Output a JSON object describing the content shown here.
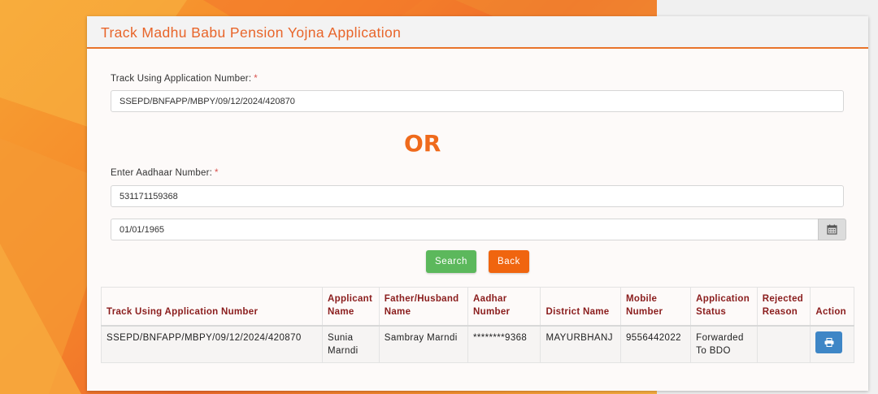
{
  "page": {
    "title": "Track Madhu Babu Pension Yojna Application",
    "or_text": "OR"
  },
  "form": {
    "app_number_label": "Track Using Application Number:",
    "app_number_value": "SSEPD/BNFAPP/MBPY/09/12/2024/420870",
    "aadhaar_label": "Enter Aadhaar Number:",
    "aadhaar_value": "531171159368",
    "dob_value": "01/01/1965",
    "required_mark": "*"
  },
  "buttons": {
    "search": "Search",
    "back": "Back"
  },
  "table": {
    "headers": [
      "Track Using Application Number",
      "Applicant Name",
      "Father/Husband Name",
      "Aadhar Number",
      "District Name",
      "Mobile Number",
      "Application Status",
      "Rejected Reason",
      "Action"
    ],
    "rows": [
      {
        "app_number": "SSEPD/BNFAPP/MBPY/09/12/2024/420870",
        "applicant": "Sunia Marndi",
        "father": "Sambray Marndi",
        "aadhar": "********9368",
        "district": "MAYURBHANJ",
        "mobile": "9556442022",
        "status": "Forwarded To BDO",
        "reason": ""
      }
    ]
  },
  "icons": {
    "calendar": "calendar-icon",
    "print": "print-icon"
  },
  "colors": {
    "accent": "#e8652a",
    "search": "#5cb85c",
    "back": "#f0650f",
    "print": "#3e86c6",
    "header_text": "#8a1c1c"
  }
}
